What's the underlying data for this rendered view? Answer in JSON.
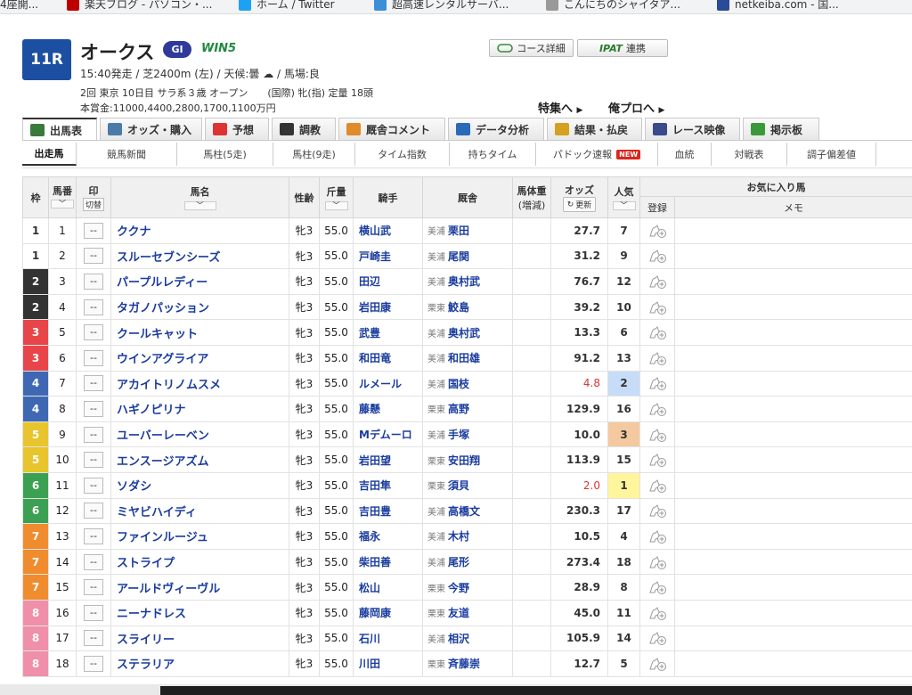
{
  "bookmarks": [
    {
      "label": "4座開...",
      "color": "#888888"
    },
    {
      "label": "楽天ブログ - パソコン・...",
      "color": "#bf0000"
    },
    {
      "label": "ホーム / Twitter",
      "color": "#1da1f2"
    },
    {
      "label": "超高速レンタルサーバ...",
      "color": "#3a8fd8"
    },
    {
      "label": "こんにちのシャイタア...",
      "color": "#999999"
    },
    {
      "label": "netkeiba.com - 国...",
      "color": "#2a4a9a"
    }
  ],
  "race": {
    "number": "11R",
    "name": "オークス",
    "grade": "GI",
    "win5": "WIN5",
    "data1": "15:40発走 / 芝2400m (左) / 天候:曇 ☁ / 馬場:良",
    "data2": "2回 東京 10日目 サラ系３歳 オープン　　(国際) 牝(指) 定量 18頭",
    "data3": "本賞金:11000,4400,2800,1700,1100万円",
    "course_btn": "コース詳細",
    "ipat_logo": "IPAT",
    "ipat_btn": "連携",
    "special_link": "特集へ",
    "blog_link": "俺プロへ"
  },
  "tabs": [
    {
      "label": "出馬表",
      "active": true,
      "color": "#3a7a3a"
    },
    {
      "label": "オッズ・購入",
      "active": false,
      "color": "#4a7aa8"
    },
    {
      "label": "予想",
      "active": false,
      "color": "#d33"
    },
    {
      "label": "調教",
      "active": false,
      "color": "#333"
    },
    {
      "label": "厩舎コメント",
      "active": false,
      "color": "#e08a2a"
    },
    {
      "label": "データ分析",
      "active": false,
      "color": "#2a6ab8"
    },
    {
      "label": "結果・払戻",
      "active": false,
      "color": "#d4a020"
    },
    {
      "label": "レース映像",
      "active": false,
      "color": "#3a4a8a"
    },
    {
      "label": "掲示板",
      "active": false,
      "color": "#3a9a3a"
    }
  ],
  "subtabs": [
    {
      "label": "出走馬",
      "active": true,
      "new": false
    },
    {
      "label": "競馬新聞",
      "active": false,
      "new": false
    },
    {
      "label": "馬柱(5走)",
      "active": false,
      "new": false
    },
    {
      "label": "馬柱(9走)",
      "active": false,
      "new": false
    },
    {
      "label": "タイム指数",
      "active": false,
      "new": false
    },
    {
      "label": "持ちタイム",
      "active": false,
      "new": false
    },
    {
      "label": "パドック速報",
      "active": false,
      "new": true
    },
    {
      "label": "血統",
      "active": false,
      "new": false
    },
    {
      "label": "対戦表",
      "active": false,
      "new": false
    },
    {
      "label": "調子偏差値",
      "active": false,
      "new": false
    }
  ],
  "new_badge": "NEW",
  "table": {
    "headers": {
      "waku": "枠",
      "umaban": "馬番",
      "mark": "印",
      "kiri": "切替",
      "horse": "馬名",
      "sexage": "性齢",
      "weight": "斤量",
      "jockey": "騎手",
      "stable": "厩舎",
      "body1": "馬体重",
      "body2": "(増減)",
      "odds": "オッズ",
      "refresh": "更新",
      "pop": "人気",
      "fav": "お気に入り馬",
      "reg": "登録",
      "memo": "メモ"
    },
    "sort_glyph": "﹀",
    "mark_default": "--",
    "rows": [
      {
        "waku": "1",
        "umaban": "1",
        "horse": "ククナ",
        "sexage": "牝3",
        "weight": "55.0",
        "jockey": "横山武",
        "region": "美浦",
        "trainer": "栗田",
        "odds": "27.7",
        "pop": "7",
        "hot": false
      },
      {
        "waku": "1",
        "umaban": "2",
        "horse": "スルーセブンシーズ",
        "sexage": "牝3",
        "weight": "55.0",
        "jockey": "戸崎圭",
        "region": "美浦",
        "trainer": "尾関",
        "odds": "31.2",
        "pop": "9",
        "hot": false
      },
      {
        "waku": "2",
        "umaban": "3",
        "horse": "パープルレディー",
        "sexage": "牝3",
        "weight": "55.0",
        "jockey": "田辺",
        "region": "美浦",
        "trainer": "奥村武",
        "odds": "76.7",
        "pop": "12",
        "hot": false
      },
      {
        "waku": "2",
        "umaban": "4",
        "horse": "タガノパッション",
        "sexage": "牝3",
        "weight": "55.0",
        "jockey": "岩田康",
        "region": "栗東",
        "trainer": "鮫島",
        "odds": "39.2",
        "pop": "10",
        "hot": false
      },
      {
        "waku": "3",
        "umaban": "5",
        "horse": "クールキャット",
        "sexage": "牝3",
        "weight": "55.0",
        "jockey": "武豊",
        "region": "美浦",
        "trainer": "奥村武",
        "odds": "13.3",
        "pop": "6",
        "hot": false
      },
      {
        "waku": "3",
        "umaban": "6",
        "horse": "ウインアグライア",
        "sexage": "牝3",
        "weight": "55.0",
        "jockey": "和田竜",
        "region": "美浦",
        "trainer": "和田雄",
        "odds": "91.2",
        "pop": "13",
        "hot": false
      },
      {
        "waku": "4",
        "umaban": "7",
        "horse": "アカイトリノムスメ",
        "sexage": "牝3",
        "weight": "55.0",
        "jockey": "ルメール",
        "region": "美浦",
        "trainer": "国枝",
        "odds": "4.8",
        "pop": "2",
        "hot": true
      },
      {
        "waku": "4",
        "umaban": "8",
        "horse": "ハギノピリナ",
        "sexage": "牝3",
        "weight": "55.0",
        "jockey": "藤懸",
        "region": "栗東",
        "trainer": "高野",
        "odds": "129.9",
        "pop": "16",
        "hot": false
      },
      {
        "waku": "5",
        "umaban": "9",
        "horse": "ユーバーレーベン",
        "sexage": "牝3",
        "weight": "55.0",
        "jockey": "Mデムーロ",
        "region": "美浦",
        "trainer": "手塚",
        "odds": "10.0",
        "pop": "3",
        "hot": false
      },
      {
        "waku": "5",
        "umaban": "10",
        "horse": "エンスージアズム",
        "sexage": "牝3",
        "weight": "55.0",
        "jockey": "岩田望",
        "region": "栗東",
        "trainer": "安田翔",
        "odds": "113.9",
        "pop": "15",
        "hot": false
      },
      {
        "waku": "6",
        "umaban": "11",
        "horse": "ソダシ",
        "sexage": "牝3",
        "weight": "55.0",
        "jockey": "吉田隼",
        "region": "栗東",
        "trainer": "須貝",
        "odds": "2.0",
        "pop": "1",
        "hot": true
      },
      {
        "waku": "6",
        "umaban": "12",
        "horse": "ミヤビハイディ",
        "sexage": "牝3",
        "weight": "55.0",
        "jockey": "吉田豊",
        "region": "美浦",
        "trainer": "高橋文",
        "odds": "230.3",
        "pop": "17",
        "hot": false
      },
      {
        "waku": "7",
        "umaban": "13",
        "horse": "ファインルージュ",
        "sexage": "牝3",
        "weight": "55.0",
        "jockey": "福永",
        "region": "美浦",
        "trainer": "木村",
        "odds": "10.5",
        "pop": "4",
        "hot": false
      },
      {
        "waku": "7",
        "umaban": "14",
        "horse": "ストライプ",
        "sexage": "牝3",
        "weight": "55.0",
        "jockey": "柴田善",
        "region": "美浦",
        "trainer": "尾形",
        "odds": "273.4",
        "pop": "18",
        "hot": false
      },
      {
        "waku": "7",
        "umaban": "15",
        "horse": "アールドヴィーヴル",
        "sexage": "牝3",
        "weight": "55.0",
        "jockey": "松山",
        "region": "栗東",
        "trainer": "今野",
        "odds": "28.9",
        "pop": "8",
        "hot": false
      },
      {
        "waku": "8",
        "umaban": "16",
        "horse": "ニーナドレス",
        "sexage": "牝3",
        "weight": "55.0",
        "jockey": "藤岡康",
        "region": "栗東",
        "trainer": "友道",
        "odds": "45.0",
        "pop": "11",
        "hot": false
      },
      {
        "waku": "8",
        "umaban": "17",
        "horse": "スライリー",
        "sexage": "牝3",
        "weight": "55.0",
        "jockey": "石川",
        "region": "美浦",
        "trainer": "相沢",
        "odds": "105.9",
        "pop": "14",
        "hot": false
      },
      {
        "waku": "8",
        "umaban": "18",
        "horse": "ステラリア",
        "sexage": "牝3",
        "weight": "55.0",
        "jockey": "川田",
        "region": "栗東",
        "trainer": "斉藤崇",
        "odds": "12.7",
        "pop": "5",
        "hot": false
      }
    ]
  },
  "colors": {
    "waku": {
      "1": "#ffffff",
      "2": "#333333",
      "3": "#e8454a",
      "4": "#3f68b4",
      "5": "#e8c52c",
      "6": "#3ba051",
      "7": "#f08c2e",
      "8": "#ef8fa9"
    },
    "waku_text": {
      "1": "#333333",
      "2": "#ffffff",
      "3": "#ffffff",
      "4": "#ffffff",
      "5": "#ffffff",
      "6": "#ffffff",
      "7": "#ffffff",
      "8": "#ffffff"
    },
    "pop": {
      "1": "#fff59d",
      "2": "#c7dcf7",
      "3": "#f4c9a0"
    }
  }
}
